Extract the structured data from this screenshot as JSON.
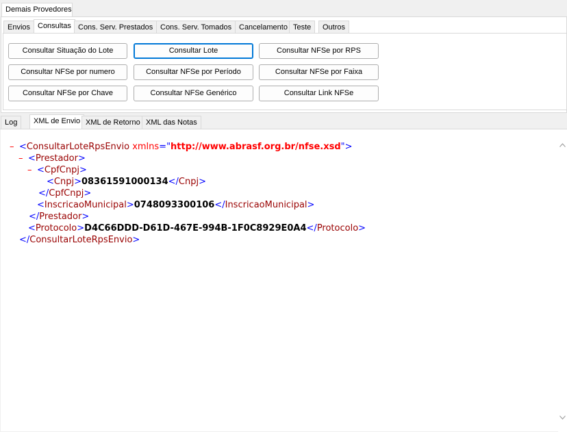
{
  "outer_tab": "Demais Provedores",
  "top_tabs": [
    "Envios",
    "Consultas",
    "Cons. Serv. Prestados",
    "Cons. Serv. Tomados",
    "Cancelamento",
    "Teste",
    "Outros"
  ],
  "active_top_tab": "Consultas",
  "buttons": [
    "Consultar Situação do Lote",
    "Consultar Lote",
    "Consultar NFSe por RPS",
    "Consultar NFSe por numero",
    "Consultar NFSe por Período",
    "Consultar NFSe por Faixa",
    "Consultar NFSe por Chave",
    "Consultar NFSe Genérico",
    "Consultar Link NFSe"
  ],
  "focused_button": "Consultar Lote",
  "bottom_tabs": [
    "Log",
    "XML de Envio",
    "XML de Retorno",
    "XML das Notas"
  ],
  "active_bottom_tab": "XML de Envio",
  "xml": {
    "root_tag": "ConsultarLoteRpsEnvio",
    "xmlns_attr": "xmlns",
    "xmlns_value": "http://www.abrasf.org.br/nfse.xsd",
    "prestador_tag": "Prestador",
    "cpfcnpj_tag": "CpfCnpj",
    "cnpj_tag": "Cnpj",
    "cnpj_value": "08361591000134",
    "im_tag": "InscricaoMunicipal",
    "im_value": "0748093300106",
    "protocolo_tag": "Protocolo",
    "protocolo_value": "D4C66DDD-D61D-467E-994B-1F0C8929E0A4",
    "collapse_symbol": "–"
  }
}
